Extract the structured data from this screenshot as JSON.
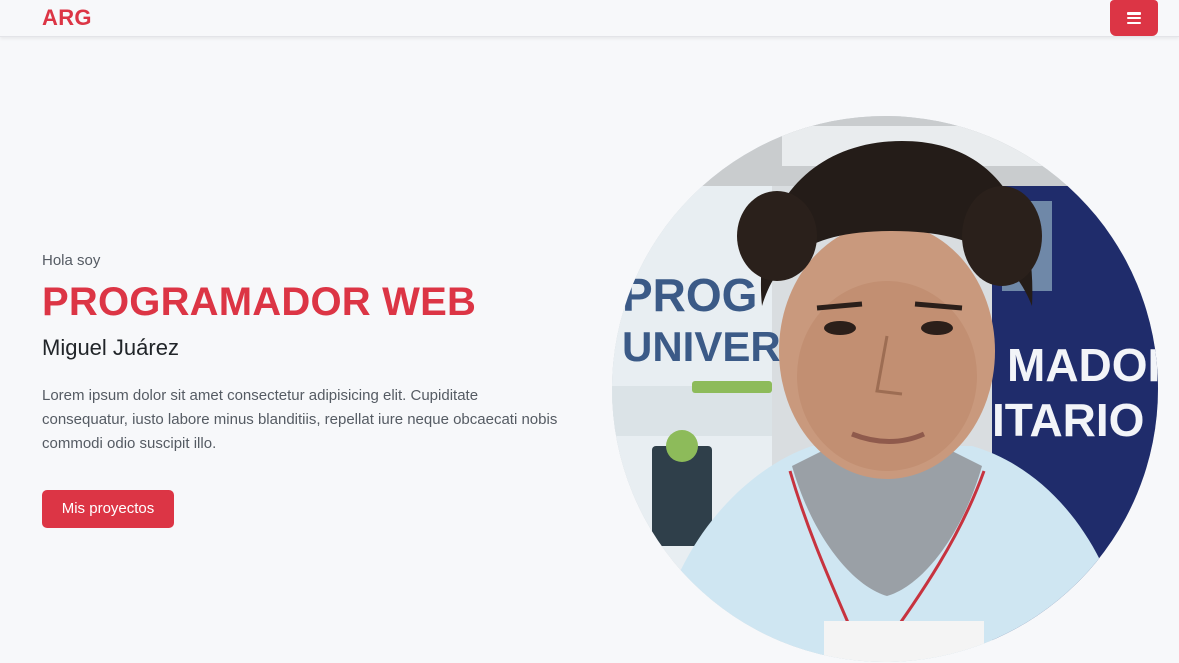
{
  "navbar": {
    "brand": "ARG",
    "menu_icon": "hamburger-menu-icon"
  },
  "hero": {
    "greeting": "Hola soy",
    "headline": "PROGRAMADOR WEB",
    "name": "Miguel Juárez",
    "description": "Lorem ipsum dolor sit amet consectetur adipisicing elit. Cupiditate consequatur, iusto labore minus blanditiis, repellat iure neque obcaecati nobis commodi odio suscipit illo.",
    "button_label": "Mis proyectos"
  },
  "profile_photo": {
    "alt_icon": "profile-photo",
    "sign_left_lines": [
      "PROG",
      "UNIVER"
    ],
    "sign_right_lines": [
      "MADOR",
      "ITARIO"
    ]
  },
  "colors": {
    "accent": "#dc3545",
    "background": "#f7f8fa",
    "text_dark": "#212529",
    "text_muted": "#555b63"
  }
}
